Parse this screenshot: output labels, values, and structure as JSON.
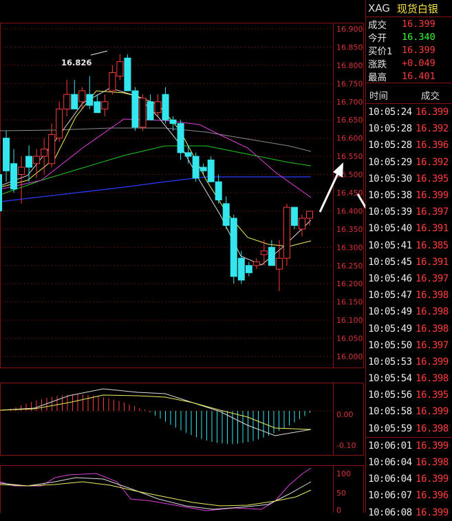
{
  "header": {
    "symbol": "XAG",
    "name": "现货白银"
  },
  "quote": [
    {
      "label": "成交",
      "value": "16.399",
      "color": "#ff3b3b"
    },
    {
      "label": "今开",
      "value": "16.340",
      "color": "#33ff33"
    },
    {
      "label": "买价1",
      "value": "16.399",
      "color": "#ff3b3b"
    },
    {
      "label": "涨跌",
      "value": "+0.049",
      "color": "#ff3b3b"
    },
    {
      "label": "最高",
      "value": "16.401",
      "color": "#ff3b3b"
    }
  ],
  "ticks_header": {
    "time": "时间",
    "price": "成交"
  },
  "ticks": [
    {
      "time": "10:05:24",
      "price": "16.399"
    },
    {
      "time": "10:05:28",
      "price": "16.392"
    },
    {
      "time": "10:05:28",
      "price": "16.396"
    },
    {
      "time": "10:05:29",
      "price": "16.392"
    },
    {
      "time": "10:05:30",
      "price": "16.395"
    },
    {
      "time": "10:05:38",
      "price": "16.399"
    },
    {
      "time": "10:05:39",
      "price": "16.397"
    },
    {
      "time": "10:05:40",
      "price": "16.391"
    },
    {
      "time": "10:05:41",
      "price": "16.385"
    },
    {
      "time": "10:05:45",
      "price": "16.391"
    },
    {
      "time": "10:05:46",
      "price": "16.397"
    },
    {
      "time": "10:05:47",
      "price": "16.398"
    },
    {
      "time": "10:05:49",
      "price": "16.398"
    },
    {
      "time": "10:05:49",
      "price": "16.398"
    },
    {
      "time": "10:05:50",
      "price": "16.397"
    },
    {
      "time": "10:05:53",
      "price": "16.399"
    },
    {
      "time": "10:05:54",
      "price": "16.398"
    },
    {
      "time": "10:05:56",
      "price": "16.395"
    },
    {
      "time": "10:05:58",
      "price": "16.399"
    },
    {
      "time": "10:05:59",
      "price": "16.398"
    },
    {
      "time": "10:06:01",
      "price": "16.399"
    },
    {
      "time": "10:06:04",
      "price": "16.398"
    },
    {
      "time": "10:06:04",
      "price": "16.399"
    },
    {
      "time": "10:06:07",
      "price": "16.396"
    },
    {
      "time": "10:06:08",
      "price": "16.399"
    }
  ],
  "colors": {
    "up": "#ff3b3b",
    "down": "#33e6ee",
    "grid": "#8a1010",
    "axis_text": "#d8333a"
  },
  "chart": {
    "high_label": "16.826",
    "price_ticks": [
      "16.900",
      "16.850",
      "16.800",
      "16.750",
      "16.700",
      "16.650",
      "16.600",
      "16.550",
      "16.500",
      "16.450",
      "16.400",
      "16.350",
      "16.300",
      "16.250",
      "16.200",
      "16.150",
      "16.100",
      "16.050",
      "16.000"
    ],
    "macd_ticks": [
      "0.00",
      "-0.10"
    ],
    "kdj_ticks": [
      "100",
      "50",
      "0"
    ],
    "candles": [
      [
        16.5,
        16.5,
        16.4,
        16.4
      ],
      [
        16.6,
        16.62,
        16.48,
        16.51
      ],
      [
        16.53,
        16.57,
        16.45,
        16.46
      ],
      [
        16.5,
        16.55,
        16.42,
        16.52
      ],
      [
        16.55,
        16.58,
        16.48,
        16.52
      ],
      [
        16.53,
        16.57,
        16.49,
        16.55
      ],
      [
        16.55,
        16.6,
        16.5,
        16.57
      ],
      [
        16.53,
        16.64,
        16.52,
        16.61
      ],
      [
        16.6,
        16.7,
        16.59,
        16.68
      ],
      [
        16.68,
        16.76,
        16.66,
        16.72
      ],
      [
        16.72,
        16.76,
        16.68,
        16.68
      ],
      [
        16.7,
        16.74,
        16.68,
        16.73
      ],
      [
        16.72,
        16.77,
        16.68,
        16.69
      ],
      [
        16.7,
        16.72,
        16.68,
        16.67
      ],
      [
        16.68,
        16.72,
        16.66,
        16.7
      ],
      [
        16.73,
        16.8,
        16.72,
        16.78
      ],
      [
        16.77,
        16.83,
        16.76,
        16.81
      ],
      [
        16.82,
        16.83,
        16.73,
        16.73
      ],
      [
        16.73,
        16.74,
        16.62,
        16.63
      ],
      [
        16.63,
        16.72,
        16.62,
        16.71
      ],
      [
        16.7,
        16.72,
        16.65,
        16.65
      ],
      [
        16.67,
        16.72,
        16.66,
        16.7
      ],
      [
        16.72,
        16.74,
        16.64,
        16.65
      ],
      [
        16.65,
        16.66,
        16.62,
        16.64
      ],
      [
        16.64,
        16.65,
        16.54,
        16.56
      ],
      [
        16.56,
        16.58,
        16.53,
        16.55
      ],
      [
        16.55,
        16.56,
        16.48,
        16.49
      ],
      [
        16.52,
        16.53,
        16.5,
        16.51
      ],
      [
        16.54,
        16.55,
        16.48,
        16.48
      ],
      [
        16.48,
        16.5,
        16.42,
        16.43
      ],
      [
        16.42,
        16.44,
        16.35,
        16.36
      ],
      [
        16.38,
        16.39,
        16.2,
        16.22
      ],
      [
        16.27,
        16.29,
        16.2,
        16.21
      ],
      [
        16.25,
        16.26,
        16.22,
        16.23
      ],
      [
        16.25,
        16.27,
        16.24,
        16.26
      ],
      [
        16.28,
        16.32,
        16.25,
        16.29
      ],
      [
        16.3,
        16.32,
        16.25,
        16.25
      ],
      [
        16.24,
        16.32,
        16.18,
        16.27
      ],
      [
        16.27,
        16.42,
        16.25,
        16.41
      ],
      [
        16.41,
        16.41,
        16.35,
        16.36
      ],
      [
        16.35,
        16.39,
        16.33,
        16.38
      ],
      [
        16.38,
        16.4,
        16.36,
        16.399
      ]
    ]
  }
}
